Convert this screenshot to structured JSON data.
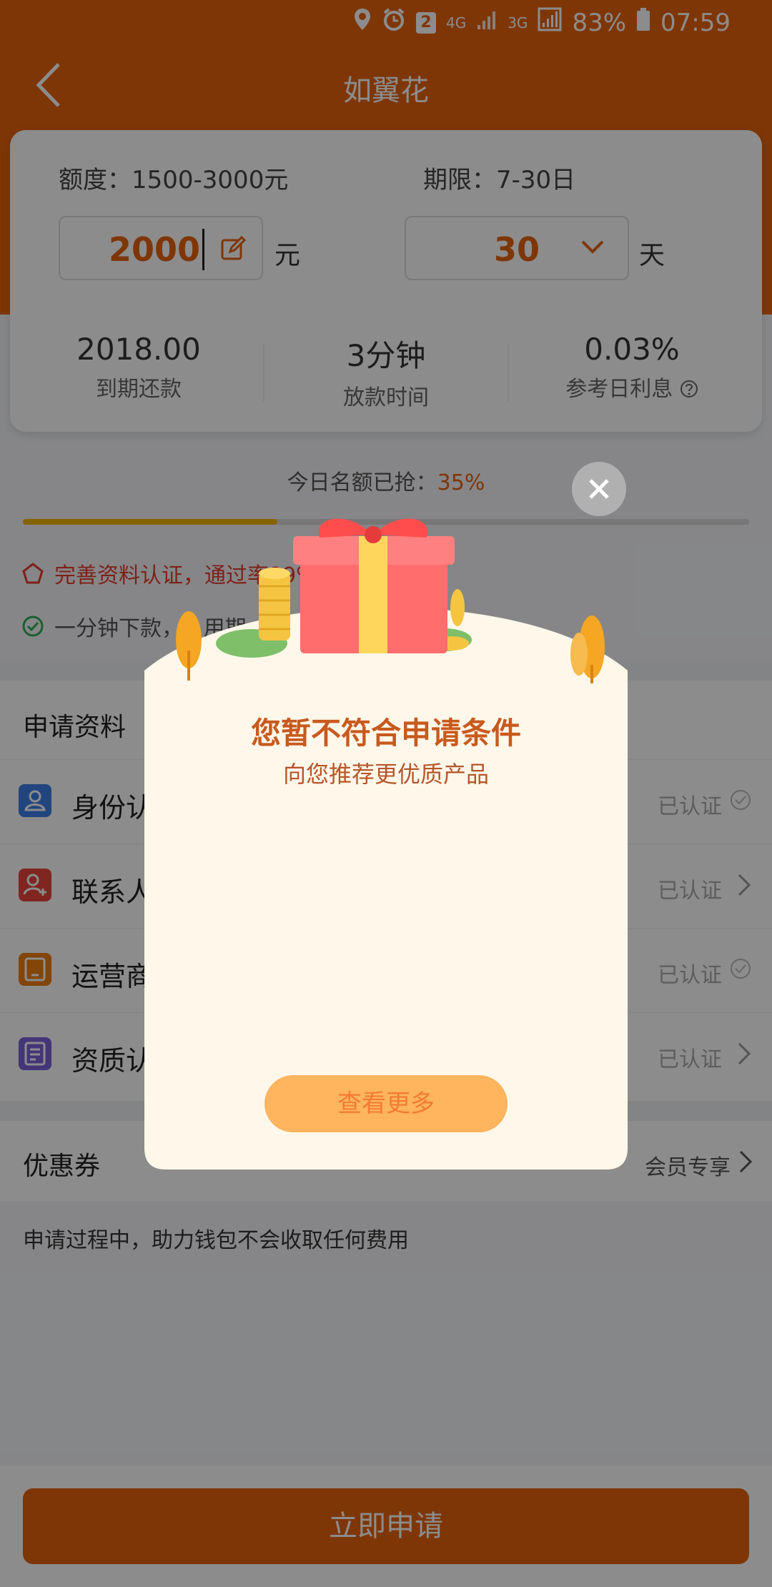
{
  "status_bar": {
    "battery": "83%",
    "time": "07:59",
    "sim_badge": "2",
    "net1": "4G",
    "net2": "3G"
  },
  "header": {
    "title": "如翼花"
  },
  "loan_card": {
    "quota_label": "额度：1500-3000元",
    "term_label": "期限：7-30日",
    "amount_value": "2000",
    "amount_unit": "元",
    "days_value": "30",
    "days_unit": "天",
    "stats": [
      {
        "value": "2018.00",
        "label": "到期还款"
      },
      {
        "value": "3分钟",
        "label": "放款时间"
      },
      {
        "value": "0.03%",
        "label": "参考日利息"
      }
    ]
  },
  "progress": {
    "label": "今日名额已抢：",
    "percent_text": "35%",
    "fraction": 0.35
  },
  "notices": [
    {
      "text": "完善资料认证，通过率99%"
    },
    {
      "text": "一分钟下款，...用期"
    }
  ],
  "application": {
    "title": "申请资料",
    "rows": [
      {
        "label": "身份认",
        "status": "已认证",
        "indicator": "check",
        "icon": "id-card-icon",
        "color": "#3f7ee8"
      },
      {
        "label": "联系人",
        "status": "已认证",
        "indicator": "chevron",
        "icon": "add-contact-icon",
        "color": "#e8453c"
      },
      {
        "label": "运营商",
        "status": "已认证",
        "indicator": "check",
        "icon": "phone-carrier-icon",
        "color": "#ef7f10"
      },
      {
        "label": "资质认",
        "status": "已认证",
        "indicator": "chevron",
        "icon": "document-icon",
        "color": "#7b61d9"
      }
    ]
  },
  "coupon": {
    "title": "优惠券",
    "link": "会员专享"
  },
  "footer_text": "申请过程中，助力钱包不会收取任何费用",
  "apply_button": "立即申请",
  "modal": {
    "title": "您暂不符合申请条件",
    "subtitle": "向您推荐更优质产品",
    "button": "查看更多"
  },
  "colors": {
    "brand": "#e6630d",
    "progress": "#f2b600",
    "modal_bg": "#fff8ea"
  }
}
